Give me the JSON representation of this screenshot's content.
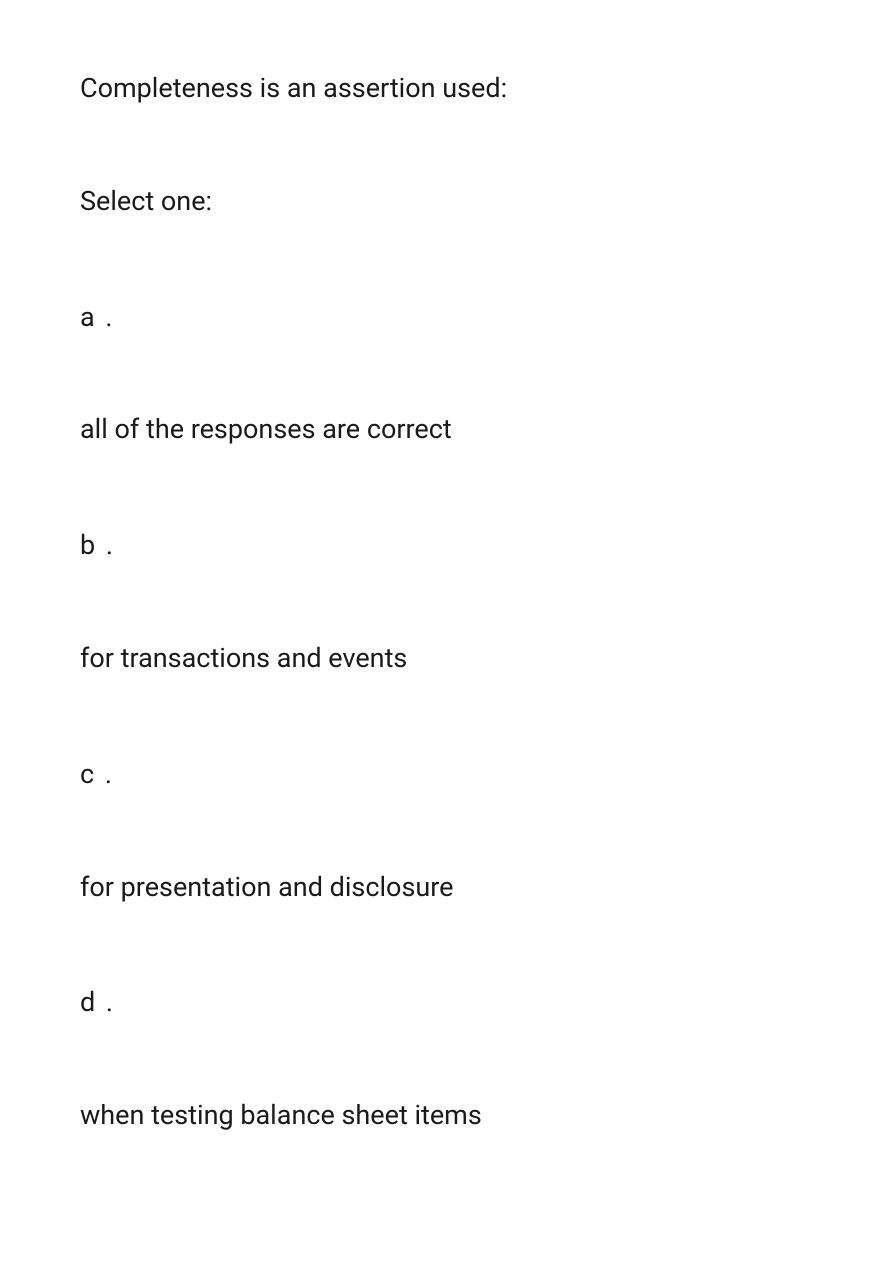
{
  "question": {
    "text": "Completeness is an assertion used:",
    "prompt": "Select one:",
    "options": [
      {
        "letter": "a .",
        "text": "all of the responses are correct"
      },
      {
        "letter": "b .",
        "text": "for transactions and events"
      },
      {
        "letter": "c .",
        "text": "for presentation and disclosure"
      },
      {
        "letter": "d .",
        "text": "when testing balance sheet items"
      }
    ]
  }
}
